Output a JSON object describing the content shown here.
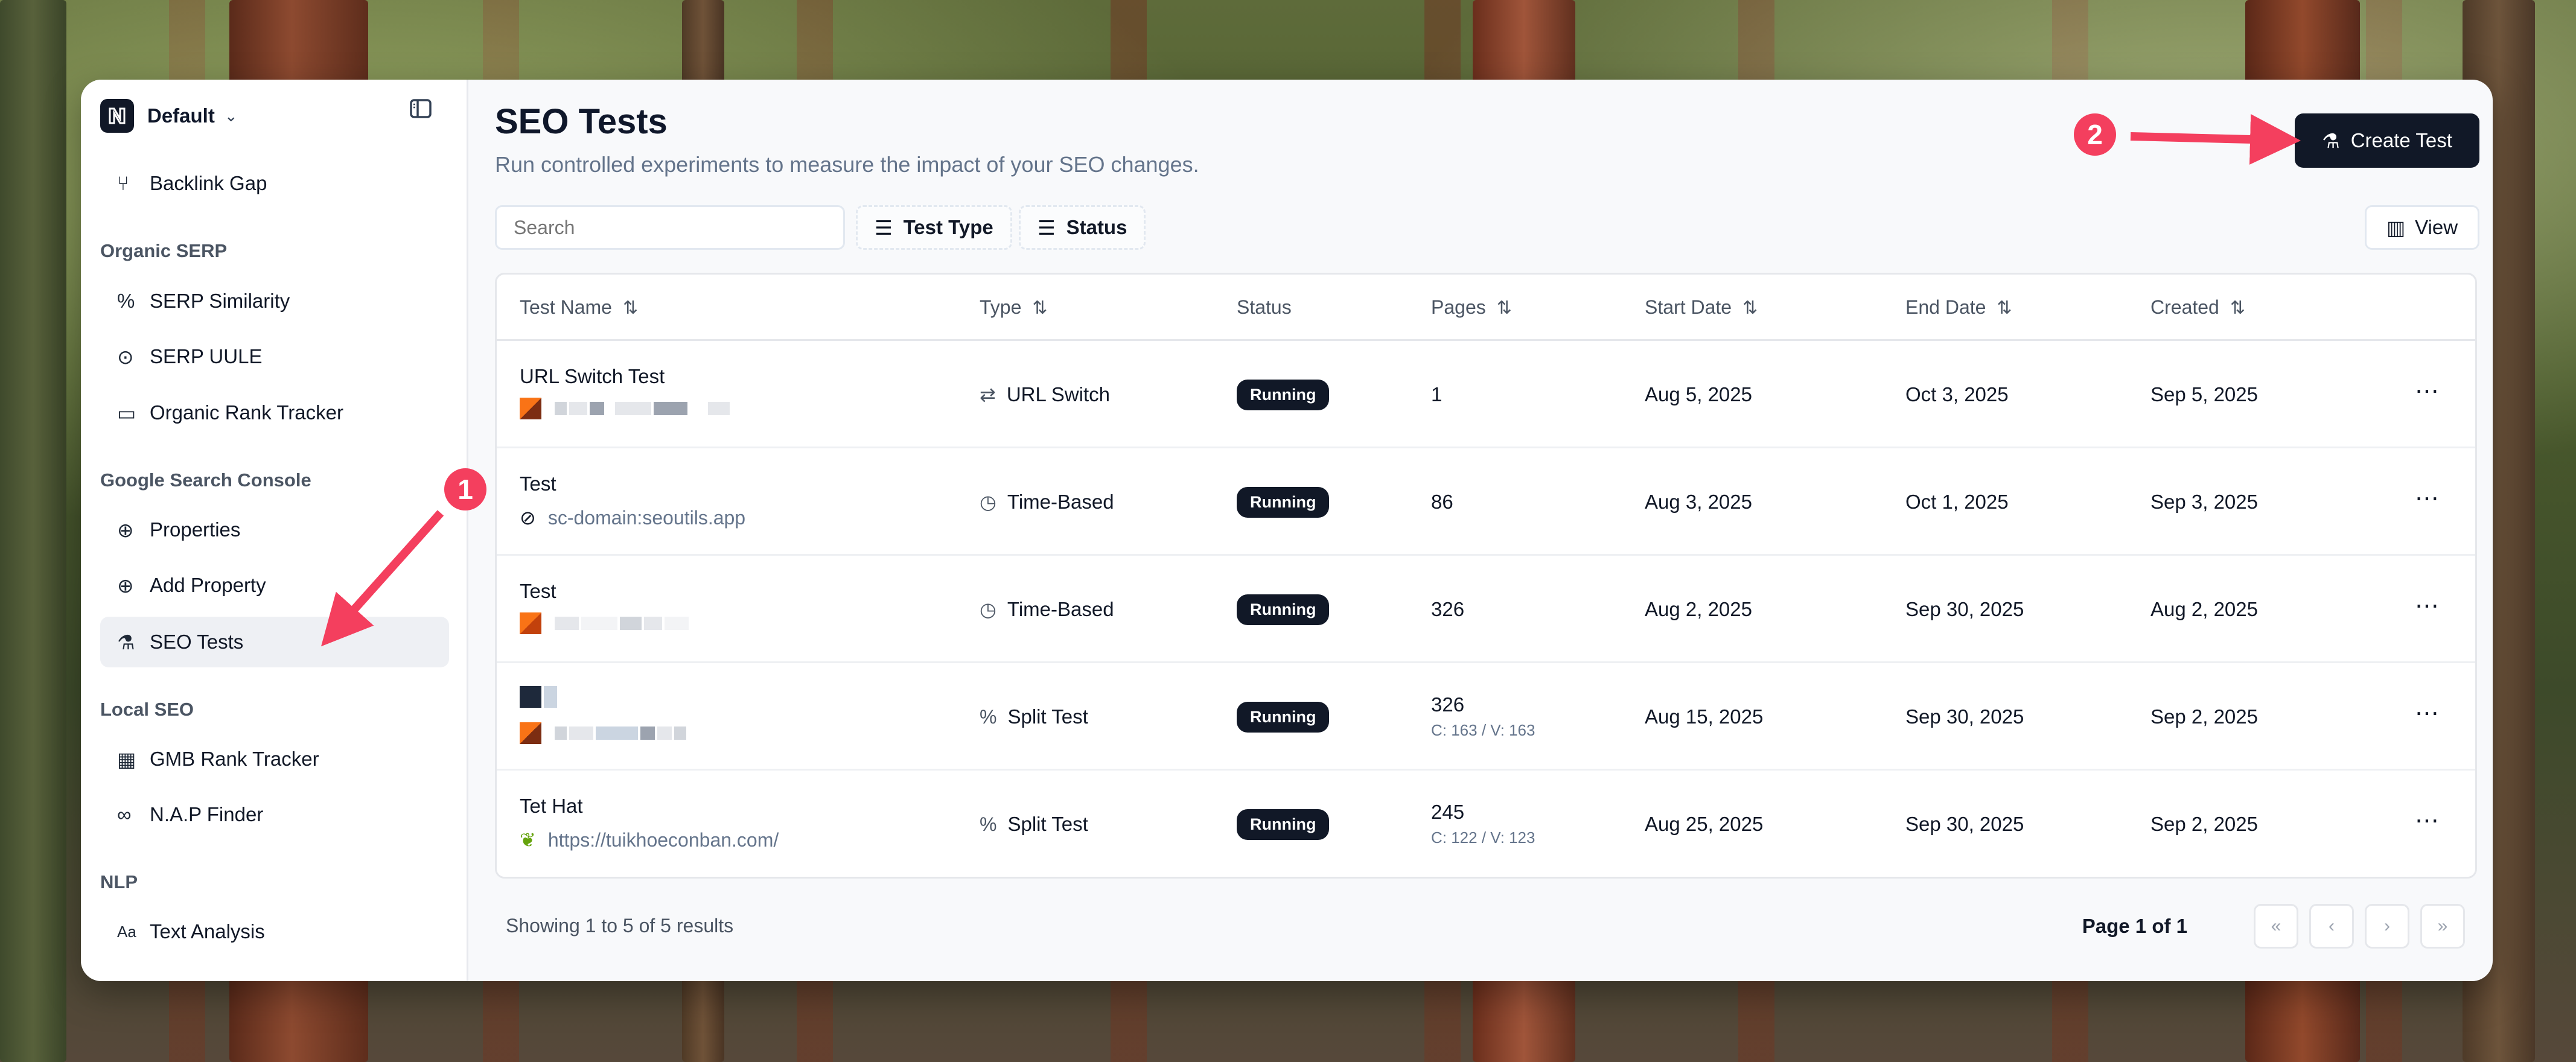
{
  "sidebar": {
    "workspace": "Default",
    "items_top": [
      {
        "label": "Backlink Gap",
        "icon": "branch-icon"
      }
    ],
    "sections": [
      {
        "title": "Organic SERP",
        "items": [
          {
            "label": "SERP Similarity",
            "icon": "percent-icon"
          },
          {
            "label": "SERP UULE",
            "icon": "map-pin-icon"
          },
          {
            "label": "Organic Rank Tracker",
            "icon": "monitor-icon"
          }
        ]
      },
      {
        "title": "Google Search Console",
        "items": [
          {
            "label": "Properties",
            "icon": "globe-icon"
          },
          {
            "label": "Add Property",
            "icon": "plus-circle-icon"
          },
          {
            "label": "SEO Tests",
            "icon": "flask-icon",
            "active": true
          }
        ]
      },
      {
        "title": "Local SEO",
        "items": [
          {
            "label": "GMB Rank Tracker",
            "icon": "map-icon"
          },
          {
            "label": "N.A.P Finder",
            "icon": "binoculars-icon"
          }
        ]
      },
      {
        "title": "NLP",
        "items": [
          {
            "label": "Text Analysis",
            "icon": "text-icon"
          }
        ]
      }
    ]
  },
  "header": {
    "title": "SEO Tests",
    "subtitle": "Run controlled experiments to measure the impact of your SEO changes.",
    "create_button": "Create Test"
  },
  "toolbar": {
    "search_placeholder": "Search",
    "filter_type": "Test Type",
    "filter_status": "Status",
    "view_button": "View"
  },
  "table": {
    "columns": [
      "Test Name",
      "Type",
      "Status",
      "Pages",
      "Start Date",
      "End Date",
      "Created"
    ],
    "rows": [
      {
        "name": "URL Switch Test",
        "property": "",
        "type": "URL Switch",
        "status": "Running",
        "pages": "1",
        "pages_split": "",
        "start": "Aug 5, 2025",
        "end": "Oct 3, 2025",
        "created": "Sep 5, 2025"
      },
      {
        "name": "Test",
        "property": "sc-domain:seoutils.app",
        "type": "Time-Based",
        "status": "Running",
        "pages": "86",
        "pages_split": "",
        "start": "Aug 3, 2025",
        "end": "Oct 1, 2025",
        "created": "Sep 3, 2025"
      },
      {
        "name": "Test",
        "property": "",
        "type": "Time-Based",
        "status": "Running",
        "pages": "326",
        "pages_split": "",
        "start": "Aug 2, 2025",
        "end": "Sep 30, 2025",
        "created": "Aug 2, 2025"
      },
      {
        "name": "",
        "property": "",
        "type": "Split Test",
        "status": "Running",
        "pages": "326",
        "pages_split": "C: 163 / V: 163",
        "start": "Aug 15, 2025",
        "end": "Sep 30, 2025",
        "created": "Sep 2, 2025"
      },
      {
        "name": "Tet Hat",
        "property": "https://tuikhoeconban.com/",
        "type": "Split Test",
        "status": "Running",
        "pages": "245",
        "pages_split": "C: 122 / V: 123",
        "start": "Aug 25, 2025",
        "end": "Sep 30, 2025",
        "created": "Sep 2, 2025"
      }
    ]
  },
  "footer": {
    "showing": "Showing 1 to 5 of 5 results",
    "page_info": "Page 1 of 1"
  },
  "annotations": {
    "marker_1": "1",
    "marker_2": "2",
    "color": "#f43f5e"
  }
}
